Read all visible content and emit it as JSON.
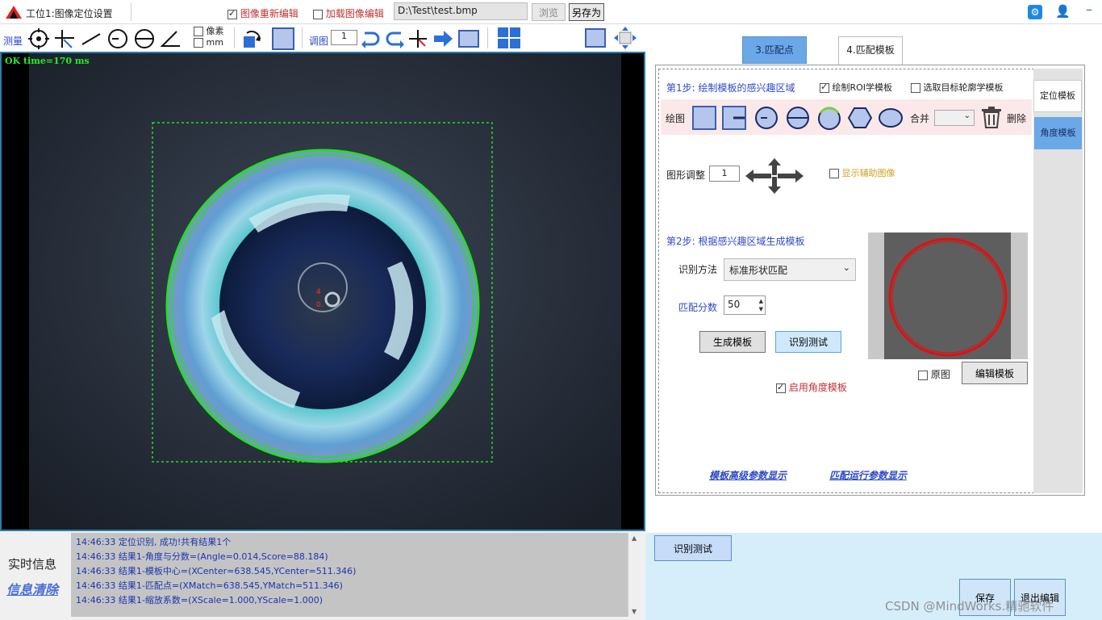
{
  "window": {
    "title": "工位1:图像定位设置",
    "re_edit_label": "图像重新编辑",
    "load_edit_label": "加载图像编辑",
    "image_path": "D:\\Test\\test.bmp",
    "browse_label": "浏览",
    "save_as_label": "另存为"
  },
  "toolbar": {
    "measure_label": "测量",
    "unit_pixel": "像素",
    "unit_mm": "mm",
    "adjust_label": "调图",
    "adjust_value": "1"
  },
  "viewer": {
    "status": "OK time=170 ms",
    "marker_top": "4",
    "marker_bottom": "0."
  },
  "tabs": {
    "match_point": "3.匹配点",
    "match_template": "4.匹配模板"
  },
  "side_tabs": {
    "locate": "定位模板",
    "angle": "角度模板"
  },
  "step1": {
    "title": "第1步: 绘制模板的感兴趣区域",
    "draw_roi": "绘制ROI学模板",
    "pick_contour": "选取目标轮廓学模板",
    "draw_label": "绘图",
    "merge_label": "合并",
    "delete_label": "删除",
    "shape_adjust_label": "图形调整",
    "shape_adjust_value": "1",
    "show_aux": "显示辅助图像"
  },
  "step2": {
    "title": "第2步: 根据感兴趣区域生成模板",
    "method_label": "识别方法",
    "method_value": "标准形状匹配",
    "score_label": "匹配分数",
    "score_value": "50",
    "generate_btn": "生成模板",
    "test_btn": "识别测试",
    "original_label": "原图",
    "edit_template_btn": "编辑模板",
    "enable_angle": "启用角度模板"
  },
  "links": {
    "advanced": "模板高级参数显示",
    "runtime": "匹配运行参数显示"
  },
  "info": {
    "title": "实时信息",
    "clear": "信息清除",
    "log": [
      "14:46:33 定位识别, 成功!共有结果1个",
      "14:46:33 结果1-角度与分数=(Angle=0.014,Score=88.184)",
      "14:46:33 结果1-模板中心=(XCenter=638.545,YCenter=511.346)",
      "14:46:33 结果1-匹配点=(XMatch=638.545,YMatch=511.346)",
      "14:46:33 结果1-缩放系数=(XScale=1.000,YScale=1.000)"
    ]
  },
  "bottom": {
    "test_btn": "识别测试",
    "save_btn": "保存",
    "exit_btn": "退出编辑",
    "watermark": "CSDN @MindWorks.精驰软件"
  },
  "colors": {
    "accent": "#2c49c6",
    "tab_active": "#6aa8e8",
    "contour": "#21e021"
  }
}
